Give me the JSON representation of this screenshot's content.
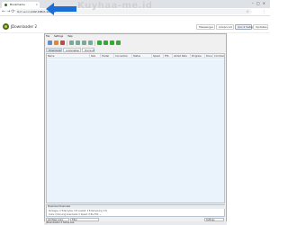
{
  "browser": {
    "tab_title": "Bookmarks",
    "insecure_label": "Not secure",
    "url": "192.168.0.102:80"
  },
  "watermark": "Kuyhaa-me.id",
  "app": {
    "title": "JDownloader 2",
    "header_buttons": [
      "Messenger",
      "Advanced",
      "Quick Setup",
      "Updates"
    ],
    "menu": [
      "File",
      "Settings",
      "Help"
    ],
    "categories": [
      "Downloads",
      "LinkGrabber",
      "Premium"
    ],
    "columns": [
      "Name",
      "Size",
      "Hoster",
      "Connection",
      "Status",
      "Speed",
      "ETA",
      "Added Date",
      "Progress",
      "Done",
      "Comment"
    ],
    "details": {
      "title": "Download Overview",
      "line1": "Packages: 0   Total bytes: 0 B   Loaded: 0 B   Remaining: 0 B",
      "line2": "Links: 0   Running downloads: 0   Speed: 0 B/s   ETA: ~"
    },
    "status": {
      "add_links": "Add New Links",
      "filter": "Filter",
      "settings": "Settings"
    },
    "download_bar": "JDownloader 2 Setup.exe"
  }
}
